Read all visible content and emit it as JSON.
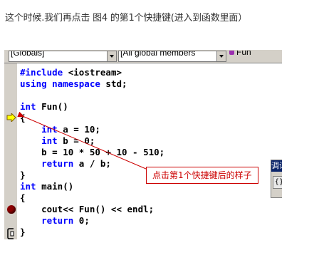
{
  "caption": "这个时候.我们再点击 图4 的第1个快捷键(进入到函数里面）",
  "toolbar": {
    "scope_combo": "[Globals]",
    "members_combo": "[All global members",
    "function_combo": "Fun"
  },
  "code_lines": [
    {
      "kw": "#include",
      "rest": " <iostream>"
    },
    {
      "kw": "using namespace",
      "rest": " std;"
    },
    {
      "kw": "",
      "rest": ""
    },
    {
      "kw": "int",
      "rest": " Fun()"
    },
    {
      "kw": "",
      "rest": "{"
    },
    {
      "kw": "    int",
      "rest": " a = 10;"
    },
    {
      "kw": "    int",
      "rest": " b = 0;"
    },
    {
      "kw": "",
      "rest": "    b = 10 * 50 + 10 - 510;"
    },
    {
      "kw": "    return",
      "rest": " a / b;"
    },
    {
      "kw": "",
      "rest": "}"
    },
    {
      "kw": "int",
      "rest": " main()"
    },
    {
      "kw": "",
      "rest": "{"
    },
    {
      "kw": "",
      "rest": "    cout<< Fun() << endl;"
    },
    {
      "kw": "    return",
      "rest": " 0;"
    },
    {
      "kw": "",
      "rest": "}"
    }
  ],
  "side_panel": {
    "title": "调试",
    "button": "{}"
  },
  "callout": "点击第1个快捷键后的样子",
  "colors": {
    "keyword": "#0000ff",
    "annotation": "#cc0000",
    "breakpoint": "#8b0000"
  }
}
